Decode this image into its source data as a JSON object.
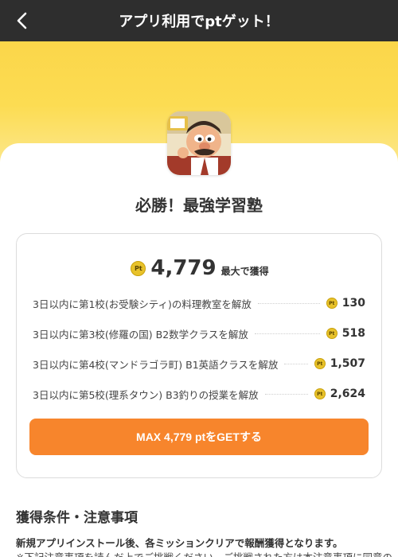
{
  "header": {
    "title": "アプリ利用でptゲット！",
    "back_icon": "chevron-left-icon"
  },
  "colors": {
    "header_bg": "#2e2e2e",
    "banner": "#fbd64a",
    "button": "#f7852c",
    "coin": "#e8c22a"
  },
  "app": {
    "name": "必勝！最強学習塾",
    "icon": "app-icon-teacher-character"
  },
  "reward": {
    "coin_label": "Pt",
    "total": "4,779",
    "total_label": "最大で獲得"
  },
  "missions": [
    {
      "text": "3日以内に第1校(お受験シティ)の料理教室を解放",
      "points": "130"
    },
    {
      "text": "3日以内に第3校(修羅の国) B2数学クラスを解放",
      "points": "518"
    },
    {
      "text": "3日以内に第4校(マンドラゴラ町) B1英語クラスを解放",
      "points": "1,507"
    },
    {
      "text": "3日以内に第5校(理系タウン) B3釣りの授業を解放",
      "points": "2,624"
    }
  ],
  "cta": {
    "label": "MAX 4,779 ptをGETする"
  },
  "conditions": {
    "title": "獲得条件・注意事項",
    "line1": "新規アプリインストール後、各ミッションクリアで報酬獲得となります。",
    "line2": "※下記注意事項を読んだ上でご挑戦ください。ご挑戦された方は本注意事項に同意の"
  }
}
